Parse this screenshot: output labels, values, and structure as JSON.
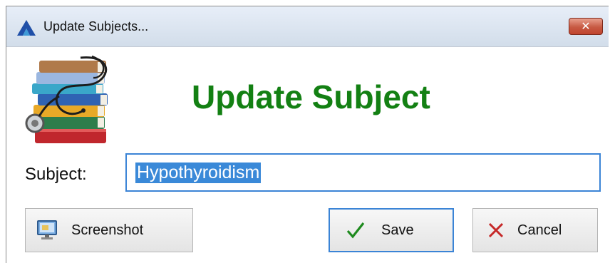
{
  "window": {
    "title": "Update Subjects...",
    "app_icon": "app-logo-icon",
    "close_icon": "close-icon"
  },
  "header": {
    "logo_icon": "books-stethoscope-icon",
    "heading": "Update Subject"
  },
  "form": {
    "subject_label": "Subject:",
    "subject_value": "Hypothyroidism",
    "subject_value_selected": true
  },
  "buttons": {
    "screenshot_label": "Screenshot",
    "screenshot_icon": "screenshot-icon",
    "save_label": "Save",
    "save_icon": "checkmark-icon",
    "cancel_label": "Cancel",
    "cancel_icon": "x-icon"
  },
  "colors": {
    "heading": "#138013",
    "focus_border": "#3b84d6",
    "selection": "#3a89d8",
    "close_button": "#c75a43"
  }
}
